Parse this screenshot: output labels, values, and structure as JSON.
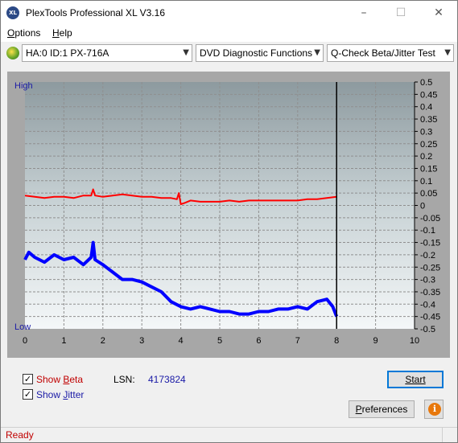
{
  "window": {
    "title": "PlexTools Professional XL V3.16",
    "app_icon": "XL",
    "minimize": "–",
    "maximize": "☐",
    "close": "✕"
  },
  "menu": {
    "options_prefix": "O",
    "options_rest": "ptions",
    "help_prefix": "H",
    "help_rest": "elp"
  },
  "toolbar": {
    "drive": "HA:0 ID:1  PX-716A",
    "function": "DVD Diagnostic Functions",
    "test": "Q-Check Beta/Jitter Test"
  },
  "chart_data": {
    "type": "line",
    "x_ticks": [
      "0",
      "1",
      "2",
      "3",
      "4",
      "5",
      "6",
      "7",
      "8",
      "9",
      "10"
    ],
    "xlim": [
      0,
      10
    ],
    "y_ticks": [
      "0.5",
      "0.45",
      "0.4",
      "0.35",
      "0.3",
      "0.25",
      "0.2",
      "0.15",
      "0.1",
      "0.05",
      "0",
      "-0.05",
      "-0.1",
      "-0.15",
      "-0.2",
      "-0.25",
      "-0.3",
      "-0.35",
      "-0.4",
      "-0.45",
      "-0.5"
    ],
    "ylim": [
      -0.5,
      0.5
    ],
    "left_axis_top": "High",
    "left_axis_bottom": "Low",
    "end_marker_x": 8.0,
    "grid": true,
    "series": [
      {
        "color": "#ff0000",
        "x": [
          0,
          0.25,
          0.5,
          0.75,
          1,
          1.25,
          1.5,
          1.7,
          1.75,
          1.8,
          2,
          2.25,
          2.5,
          2.75,
          3,
          3.25,
          3.5,
          3.75,
          3.9,
          3.95,
          4,
          4.1,
          4.25,
          4.5,
          4.75,
          5,
          5.25,
          5.5,
          5.75,
          6,
          6.25,
          6.5,
          6.75,
          7,
          7.25,
          7.5,
          7.75,
          8
        ],
        "values": [
          0.04,
          0.035,
          0.03,
          0.035,
          0.035,
          0.03,
          0.04,
          0.04,
          0.065,
          0.04,
          0.035,
          0.04,
          0.045,
          0.04,
          0.035,
          0.035,
          0.03,
          0.03,
          0.025,
          0.05,
          0.005,
          0.01,
          0.02,
          0.015,
          0.015,
          0.015,
          0.02,
          0.015,
          0.02,
          0.02,
          0.02,
          0.02,
          0.02,
          0.02,
          0.025,
          0.025,
          0.03,
          0.035
        ]
      },
      {
        "color": "#0000ff",
        "x": [
          0,
          0.1,
          0.25,
          0.5,
          0.75,
          1,
          1.25,
          1.5,
          1.7,
          1.75,
          1.8,
          2,
          2.25,
          2.5,
          2.75,
          3,
          3.25,
          3.5,
          3.75,
          4,
          4.25,
          4.5,
          4.75,
          5,
          5.25,
          5.5,
          5.75,
          6,
          6.25,
          6.5,
          6.75,
          7,
          7.25,
          7.5,
          7.75,
          7.9,
          8
        ],
        "values": [
          -0.22,
          -0.19,
          -0.21,
          -0.23,
          -0.2,
          -0.22,
          -0.21,
          -0.24,
          -0.21,
          -0.15,
          -0.22,
          -0.24,
          -0.27,
          -0.3,
          -0.3,
          -0.31,
          -0.33,
          -0.35,
          -0.39,
          -0.41,
          -0.42,
          -0.41,
          -0.42,
          -0.43,
          -0.43,
          -0.44,
          -0.44,
          -0.43,
          -0.43,
          -0.42,
          -0.42,
          -0.41,
          -0.42,
          -0.39,
          -0.38,
          -0.41,
          -0.45
        ]
      }
    ]
  },
  "bottom": {
    "show_beta_prefix": "Show ",
    "show_beta_key": "B",
    "show_beta_rest": "eta",
    "show_beta_checked": "✓",
    "show_jitter_prefix": "Show ",
    "show_jitter_key": "J",
    "show_jitter_rest": "itter",
    "show_jitter_checked": "✓",
    "beta_color": "#c00000",
    "jitter_color": "#1a1aa6",
    "lsn_label": "LSN:",
    "lsn_value": "4173824",
    "start_label": "Start",
    "preferences_prefix": "",
    "preferences_key": "P",
    "preferences_rest": "references",
    "info_icon": "i"
  },
  "status": {
    "text": "Ready"
  }
}
